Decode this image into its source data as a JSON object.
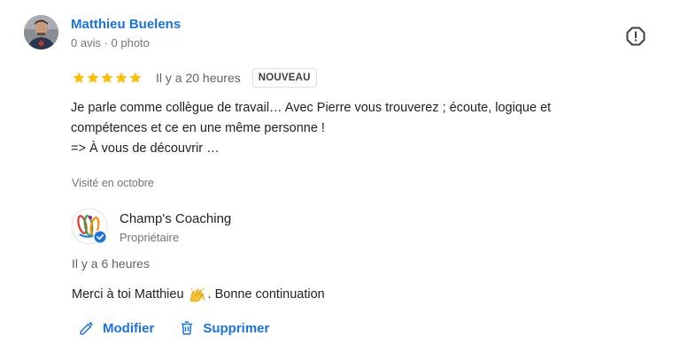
{
  "reviewer": {
    "name": "Matthieu Buelens",
    "meta": "0 avis · 0 photo"
  },
  "review": {
    "rating": 5,
    "max_rating": 5,
    "time": "Il y a 20 heures",
    "badge": "NOUVEAU",
    "lines": [
      "Je parle comme collègue de travail… Avec Pierre vous trouverez ; écoute, logique et",
      "compétences et ce en une même personne !",
      "=> À vous de découvrir …"
    ],
    "visited": "Visité en octobre"
  },
  "owner": {
    "name": "Champ's Coaching",
    "role": "Propriétaire",
    "reply_time": "Il y a 6 heures",
    "reply_before": "Merci à toi Matthieu",
    "reply_after": ". Bonne continuation"
  },
  "actions": {
    "edit_label": "Modifier",
    "delete_label": "Supprimer"
  },
  "icons": {
    "report": "report-icon",
    "edit": "pencil-icon",
    "delete": "trash-icon",
    "star": "star-icon",
    "verified": "verified-check-icon",
    "emoji": "raised-hands-icon"
  },
  "colors": {
    "accent": "#1a73e8",
    "star": "#fbbc04",
    "muted": "#70757a"
  }
}
